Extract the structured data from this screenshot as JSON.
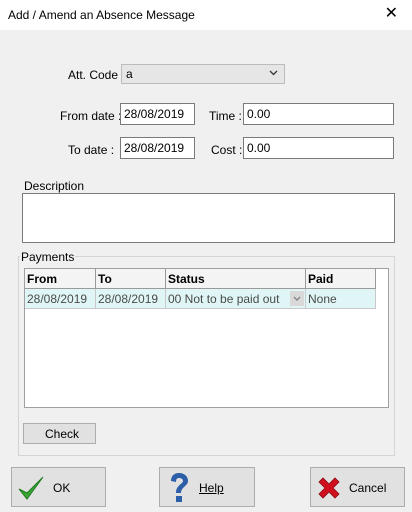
{
  "window": {
    "title": "Add / Amend an Absence Message",
    "close_glyph": "✕"
  },
  "form": {
    "att_code_label": "Att. Code",
    "att_code_value": "a",
    "from_date_label": "From date :",
    "from_date_value": "28/08/2019",
    "to_date_label": "To date :",
    "to_date_value": "28/08/2019",
    "time_label": "Time :",
    "time_value": "0.00",
    "cost_label": "Cost :",
    "cost_value": "0.00",
    "description_label": "Description",
    "description_value": ""
  },
  "payments": {
    "group_label": "Payments",
    "columns": [
      "From",
      "To",
      "Status",
      "Paid"
    ],
    "rows": [
      {
        "from": "28/08/2019",
        "to": "28/08/2019",
        "status": "00 Not to be paid out",
        "paid": "None"
      }
    ],
    "check_label": "Check"
  },
  "buttons": {
    "ok_label": "OK",
    "help_label": "Help",
    "cancel_label": "Cancel"
  },
  "colors": {
    "row_highlight": "#e0f6f6",
    "ok_check": "#3aa535",
    "help_icon": "#2d5ea8",
    "cancel_icon": "#d0101c"
  }
}
